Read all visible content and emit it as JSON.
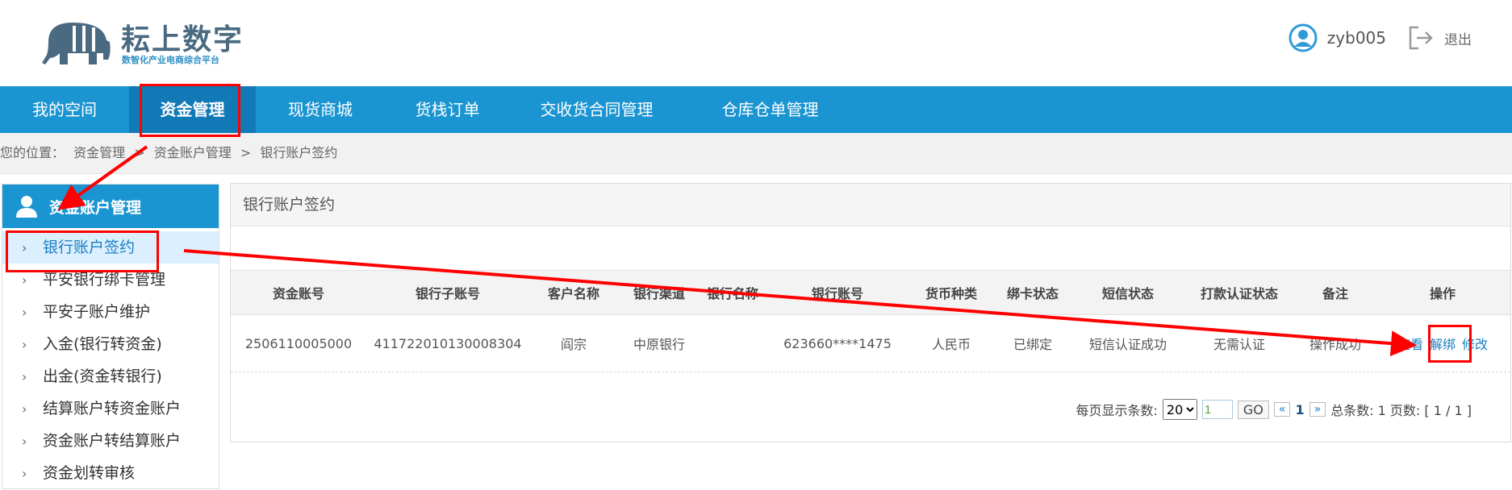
{
  "logo": {
    "title": "耘上数字",
    "subtitle": "数智化产业电商综合平台"
  },
  "user": {
    "name": "zyb005",
    "logout": "退出"
  },
  "nav": [
    "我的空间",
    "资金管理",
    "现货商城",
    "货栈订单",
    "交收货合同管理",
    "仓库仓单管理"
  ],
  "breadcrumb": [
    "您的位置：",
    "资金管理",
    ">",
    "资金账户管理",
    ">",
    "银行账户签约"
  ],
  "sidebar": {
    "title": "资金账户管理",
    "items": [
      "银行账户签约",
      "平安银行绑卡管理",
      "平安子账户维护",
      "入金(银行转资金)",
      "出金(资金转银行)",
      "结算账户转资金账户",
      "资金账户转结算账户",
      "资金划转审核"
    ]
  },
  "panel": {
    "title": "银行账户签约"
  },
  "table": {
    "headers": [
      "资金账号",
      "银行子账号",
      "客户名称",
      "银行渠道",
      "银行名称",
      "银行账号",
      "货币种类",
      "绑卡状态",
      "短信状态",
      "打款认证状态",
      "备注",
      "操作"
    ],
    "rows": [
      [
        "2506110005000",
        "411722010130008304",
        "阎宗",
        "中原银行",
        "",
        "623660****1475",
        "人民币",
        "已绑定",
        "短信认证成功",
        "无需认证",
        "操作成功"
      ]
    ],
    "actions": [
      "查看",
      "解绑",
      "修改"
    ]
  },
  "pager": {
    "per_page_label": "每页显示条数:",
    "per_page": "20",
    "page_input": "1",
    "go": "GO",
    "prev": "«",
    "current": "1",
    "next": "»",
    "summary": "总条数: 1 页数: [ 1 / 1 ]"
  },
  "colors": {
    "primary": "#1b95d1",
    "nav_active": "#1179b5",
    "link": "#1b7fc2",
    "annotation": "#ff0000"
  },
  "icons": [
    "elephant-logo-icon",
    "user-avatar-icon",
    "logout-icon",
    "person-icon",
    "chevron-right-icon"
  ]
}
